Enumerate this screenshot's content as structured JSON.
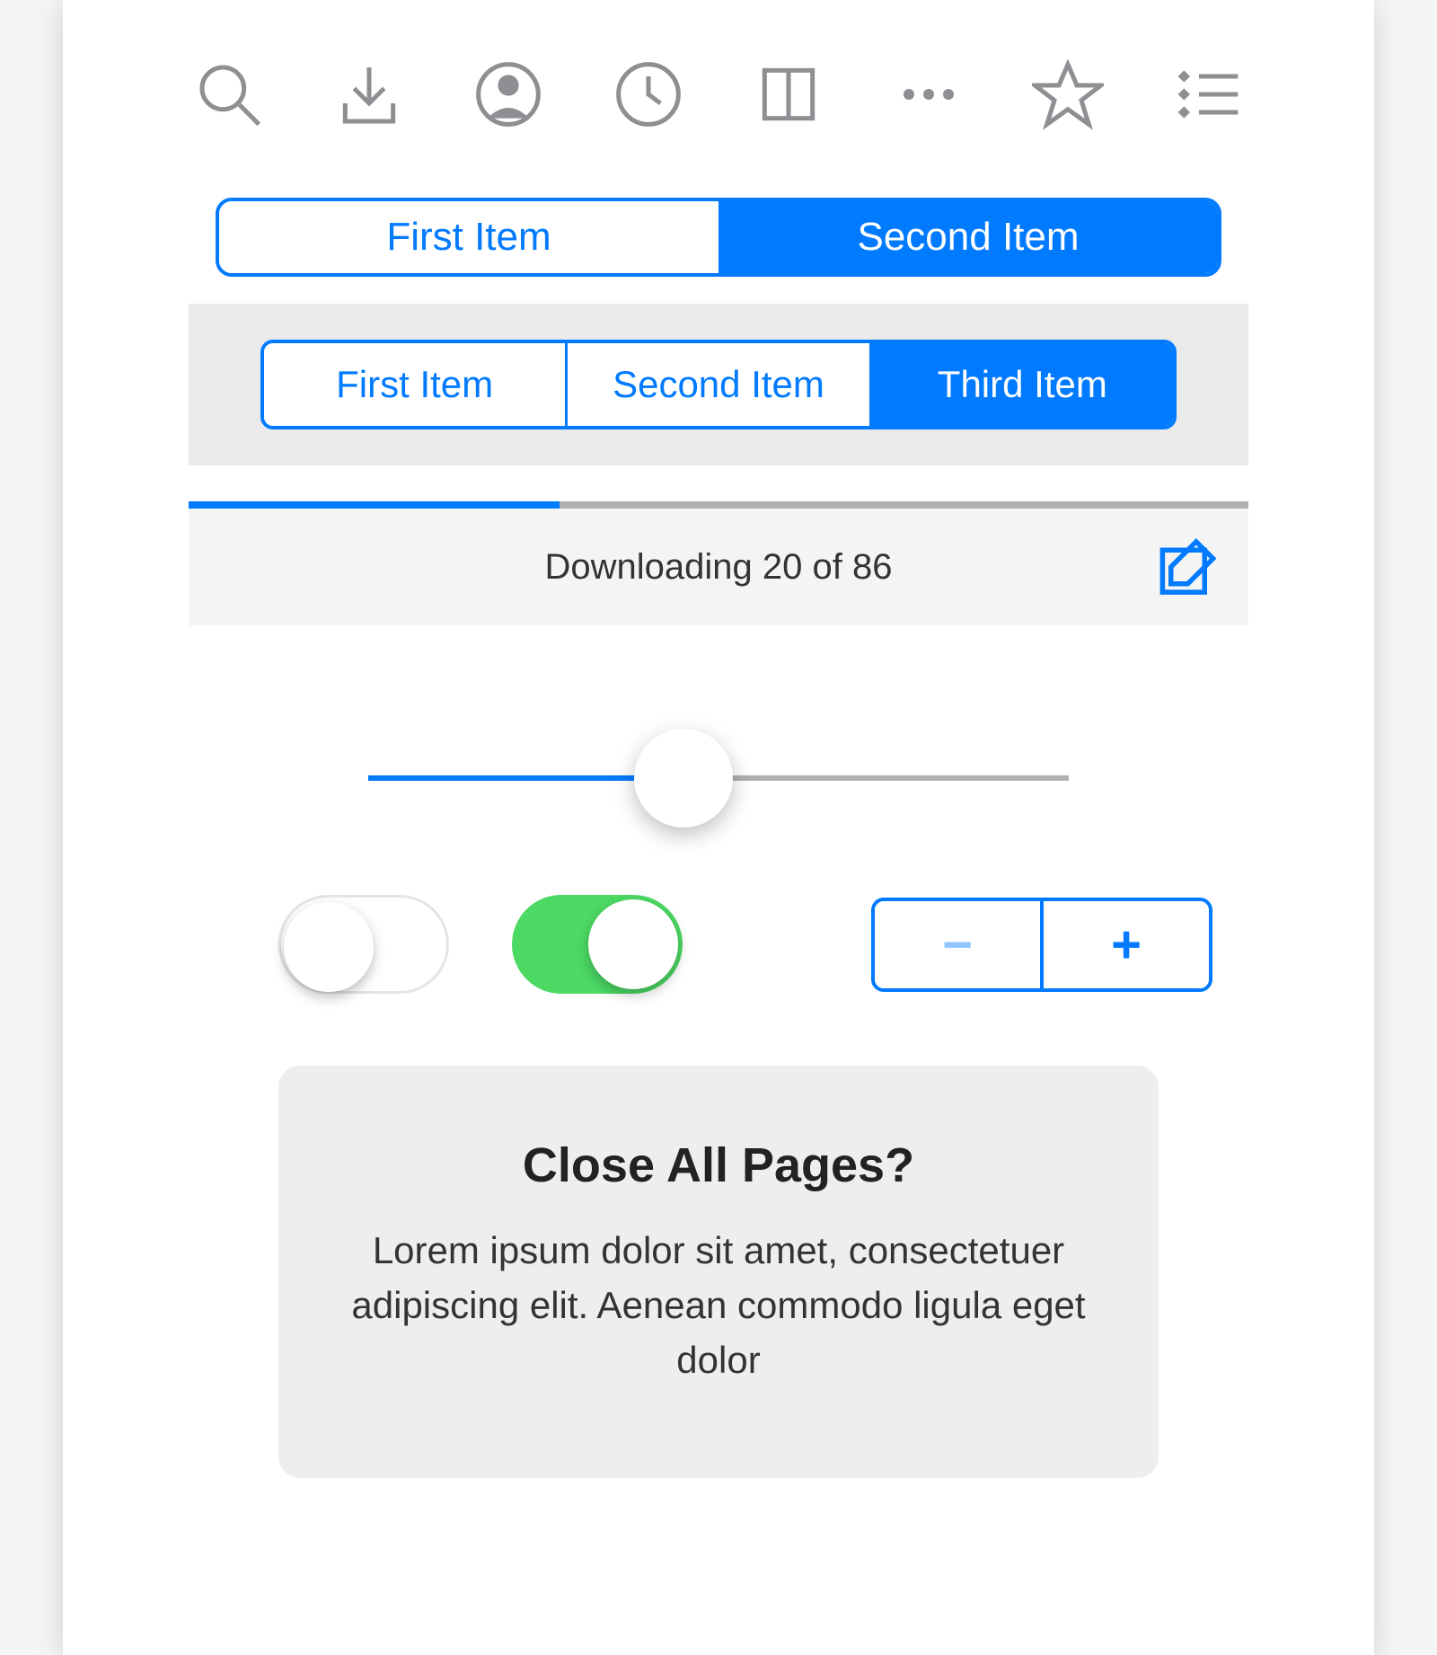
{
  "toolbar_icons": [
    "search",
    "download",
    "profile",
    "clock",
    "book",
    "more",
    "star",
    "bullet-list"
  ],
  "segment2": {
    "items": [
      "First Item",
      "Second Item"
    ],
    "active": 1
  },
  "segment3": {
    "items": [
      "First Item",
      "Second Item",
      "Third Item"
    ],
    "active": 2
  },
  "download": {
    "label": "Downloading 20 of 86",
    "progress_percent": 35
  },
  "slider": {
    "value_percent": 45
  },
  "toggles": {
    "left": false,
    "right": true
  },
  "stepper": {
    "minus": "−",
    "plus": "+"
  },
  "alert": {
    "title": "Close All Pages?",
    "body": "Lorem ipsum dolor sit amet, consectetuer adipiscing elit. Aenean commodo ligula eget dolor"
  }
}
